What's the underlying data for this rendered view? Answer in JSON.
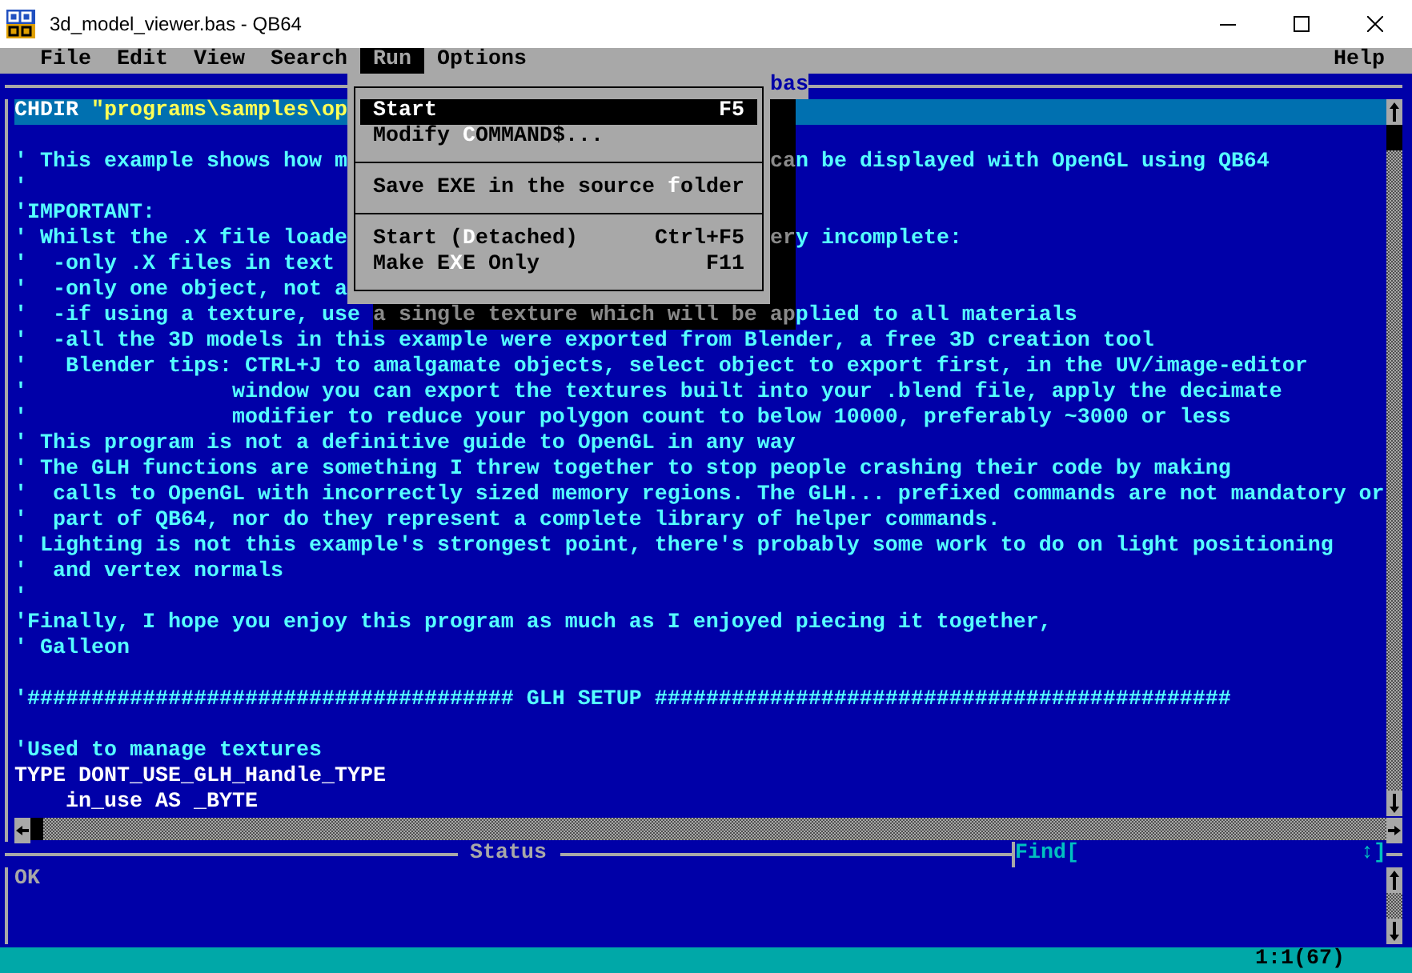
{
  "window": {
    "title": "3d_model_viewer.bas - QB64"
  },
  "menu_bar": {
    "items": [
      {
        "label": "File",
        "selected": false
      },
      {
        "label": "Edit",
        "selected": false
      },
      {
        "label": "View",
        "selected": false
      },
      {
        "label": "Search",
        "selected": false
      },
      {
        "label": "Run",
        "selected": true
      },
      {
        "label": "Options",
        "selected": false
      }
    ],
    "help": "Help"
  },
  "editor": {
    "title": "bas",
    "lines": [
      {
        "selected": true,
        "behind_menu": true,
        "left": [
          {
            "kind": "code",
            "text": "CHDIR "
          },
          {
            "kind": "string",
            "text": "\"programs\\samples\\op"
          }
        ]
      },
      {
        "selected": false,
        "behind_menu": true
      },
      {
        "selected": false,
        "behind_menu": true,
        "left": [
          {
            "kind": "comment",
            "text": "' This example shows how m"
          }
        ],
        "shadow": "ca",
        "right": [
          {
            "kind": "comment",
            "text": "n be displayed with OpenGL using QB64"
          }
        ]
      },
      {
        "selected": false,
        "behind_menu": true,
        "left": [
          {
            "kind": "comment",
            "text": "'"
          }
        ]
      },
      {
        "selected": false,
        "behind_menu": true,
        "left": [
          {
            "kind": "comment",
            "text": "'IMPORTANT:"
          }
        ]
      },
      {
        "selected": false,
        "behind_menu": true,
        "left": [
          {
            "kind": "comment",
            "text": "' Whilst the .X file loade"
          }
        ],
        "shadow": "er",
        "right": [
          {
            "kind": "comment",
            "text": "y incomplete:"
          }
        ]
      },
      {
        "selected": false,
        "behind_menu": true,
        "left": [
          {
            "kind": "comment",
            "text": "'  -only .X files in text"
          }
        ]
      },
      {
        "selected": false,
        "behind_menu": true,
        "left": [
          {
            "kind": "comment",
            "text": "'  -only one object, not a"
          }
        ]
      },
      {
        "selected": false,
        "behind_menu": false,
        "left": [
          {
            "kind": "comment",
            "text": "'  -if using a texture, use "
          }
        ],
        "shadow": "a single texture which will be ap",
        "right": [
          {
            "kind": "comment",
            "text": "plied to all materials"
          }
        ]
      },
      {
        "selected": false,
        "behind_menu": false,
        "left": [
          {
            "kind": "comment",
            "text": "'  -all the 3D models in this example were exported from Blender, a free 3D creation tool"
          }
        ]
      },
      {
        "selected": false,
        "behind_menu": false,
        "left": [
          {
            "kind": "comment",
            "text": "'   Blender tips: CTRL+J to amalgamate objects, select object to export first, in the UV/image-editor"
          }
        ]
      },
      {
        "selected": false,
        "behind_menu": false,
        "left": [
          {
            "kind": "comment",
            "text": "'                window you can export the textures built into your .blend file, apply the decimate"
          }
        ]
      },
      {
        "selected": false,
        "behind_menu": false,
        "left": [
          {
            "kind": "comment",
            "text": "'                modifier to reduce your polygon count to below 10000, preferably ~3000 or less"
          }
        ]
      },
      {
        "selected": false,
        "behind_menu": false,
        "left": [
          {
            "kind": "comment",
            "text": "' This program is not a definitive guide to OpenGL in any way"
          }
        ]
      },
      {
        "selected": false,
        "behind_menu": false,
        "left": [
          {
            "kind": "comment",
            "text": "' The GLH functions are something I threw together to stop people crashing their code by making"
          }
        ]
      },
      {
        "selected": false,
        "behind_menu": false,
        "left": [
          {
            "kind": "comment",
            "text": "'  calls to OpenGL with incorrectly sized memory regions. The GLH... prefixed commands are not mandatory or"
          }
        ]
      },
      {
        "selected": false,
        "behind_menu": false,
        "left": [
          {
            "kind": "comment",
            "text": "'  part of QB64, nor do they represent a complete library of helper commands."
          }
        ]
      },
      {
        "selected": false,
        "behind_menu": false,
        "left": [
          {
            "kind": "comment",
            "text": "' Lighting is not this example's strongest point, there's probably some work to do on light positioning"
          }
        ]
      },
      {
        "selected": false,
        "behind_menu": false,
        "left": [
          {
            "kind": "comment",
            "text": "'  and vertex normals"
          }
        ]
      },
      {
        "selected": false,
        "behind_menu": false,
        "left": [
          {
            "kind": "comment",
            "text": "'"
          }
        ]
      },
      {
        "selected": false,
        "behind_menu": false,
        "left": [
          {
            "kind": "comment",
            "text": "'Finally, I hope you enjoy this program as much as I enjoyed piecing it together,"
          }
        ]
      },
      {
        "selected": false,
        "behind_menu": false,
        "left": [
          {
            "kind": "comment",
            "text": "' Galleon"
          }
        ]
      },
      {
        "selected": false,
        "behind_menu": false
      },
      {
        "selected": false,
        "behind_menu": false,
        "left": [
          {
            "kind": "comment",
            "text": "'###################################### GLH SETUP #############################################"
          }
        ]
      },
      {
        "selected": false,
        "behind_menu": false
      },
      {
        "selected": false,
        "behind_menu": false,
        "left": [
          {
            "kind": "comment",
            "text": "'Used to manage textures"
          }
        ]
      },
      {
        "selected": false,
        "behind_menu": false,
        "left": [
          {
            "kind": "code",
            "text": "TYPE DONT_USE_GLH_Handle_TYPE"
          }
        ]
      },
      {
        "selected": false,
        "behind_menu": false,
        "left": [
          {
            "kind": "code",
            "text": "    in_use AS _BYTE"
          }
        ]
      }
    ]
  },
  "run_menu": {
    "items": [
      {
        "kind": "item",
        "hotkey": "S",
        "after": "tart",
        "shortcut": "F5",
        "selected": true
      },
      {
        "kind": "item",
        "before": "Modify ",
        "hotkey": "C",
        "after": "OMMAND$...",
        "selected": false
      },
      {
        "kind": "separator"
      },
      {
        "kind": "item",
        "before": "Save EXE in the source ",
        "hotkey": "f",
        "after": "older",
        "selected": false
      },
      {
        "kind": "separator"
      },
      {
        "kind": "item",
        "before": "Start (",
        "hotkey": "D",
        "after": "etached)",
        "shortcut": "Ctrl+F5",
        "selected": false
      },
      {
        "kind": "item",
        "before": "Make E",
        "hotkey": "X",
        "after": "E Only",
        "shortcut": "F11",
        "selected": false
      }
    ]
  },
  "status": {
    "title": "Status",
    "message": "OK"
  },
  "find": {
    "label": "Find[",
    "end": "↕]"
  },
  "position": "1:1(67)"
}
